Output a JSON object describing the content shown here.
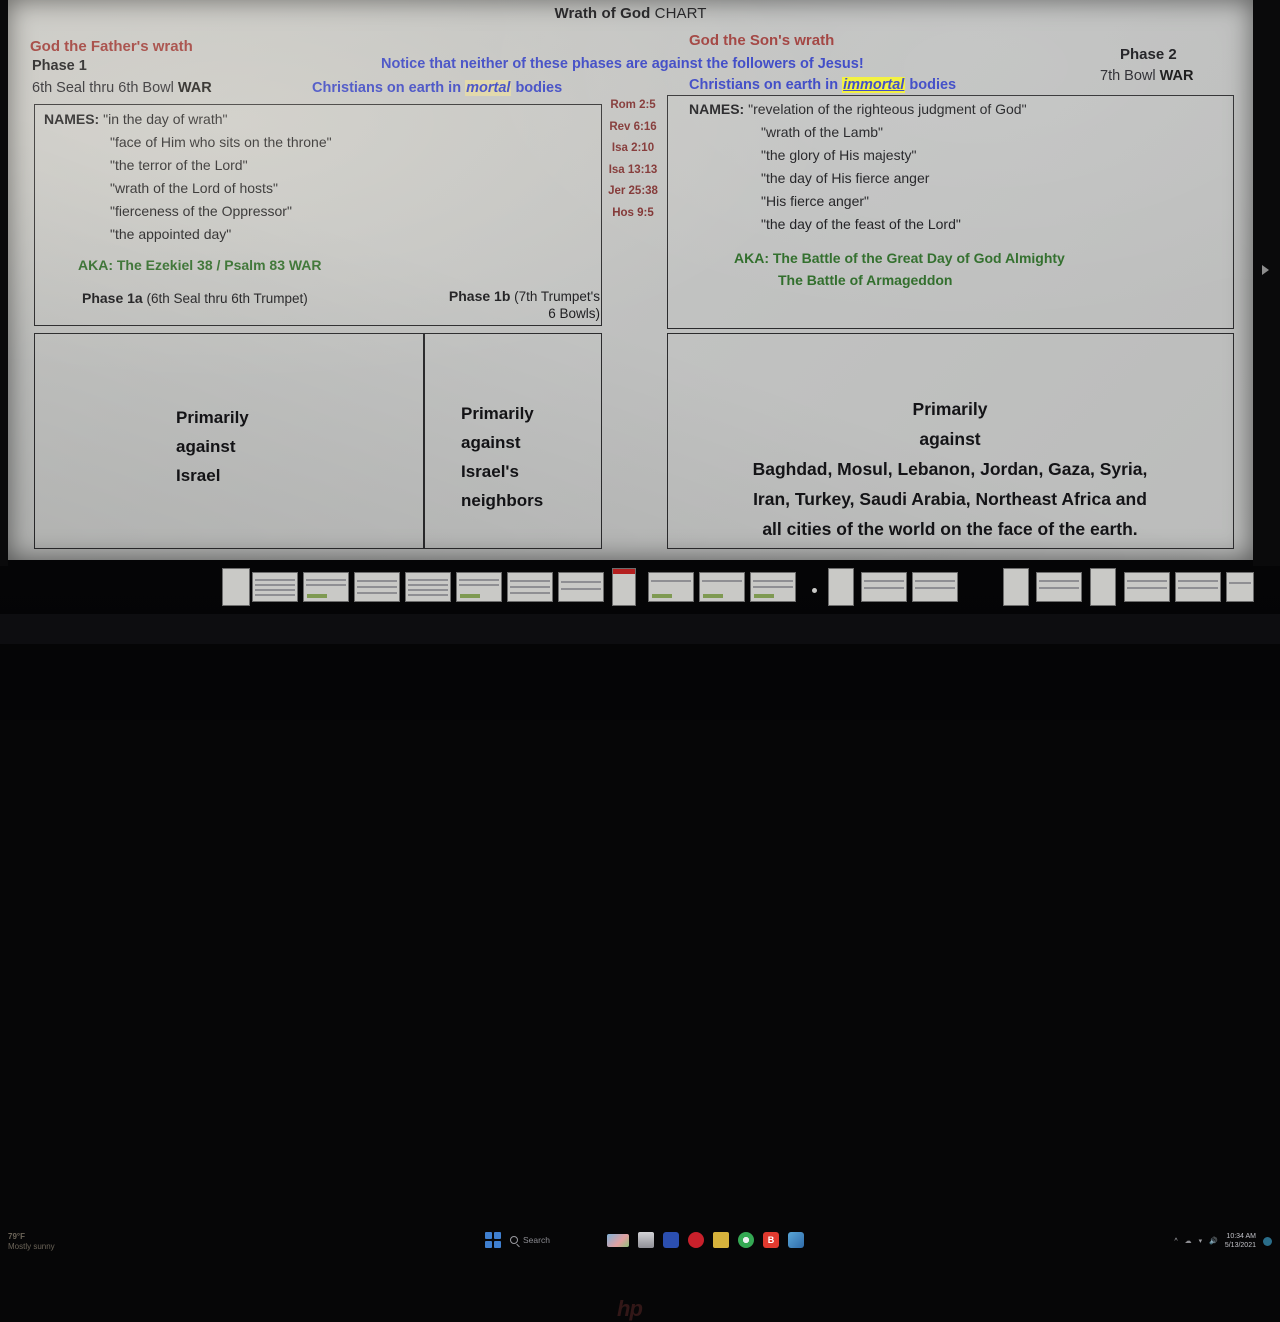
{
  "slide": {
    "title_bold": "Wrath of God",
    "title_rest": " CHART",
    "father": {
      "heading": "God the Father's wrath",
      "phase": "Phase 1",
      "sub_plain": "6th Seal thru 6th Bowl ",
      "sub_bold": "WAR"
    },
    "son": {
      "heading": "God the Son's wrath",
      "phase": "Phase 2",
      "sub_plain": "7th Bowl ",
      "sub_bold": "WAR"
    },
    "notice": "Notice that neither of these phases are against the followers of Jesus!",
    "mortal_line": {
      "pre": "Christians on earth in ",
      "highlight": "mortal",
      "post": " bodies"
    },
    "immortal_line": {
      "pre": "Christians on earth in ",
      "highlight": "immortal",
      "post": " bodies"
    },
    "references": [
      "Rom 2:5",
      "Rev 6:16",
      "Isa 2:10",
      "Isa 13:13",
      "Jer 25:38",
      "Hos 9:5"
    ],
    "left_panel": {
      "names_label": "NAMES:",
      "names": [
        "\"in the day of wrath\"",
        "\"face of Him who sits on the throne\"",
        "\"the terror of the Lord\"",
        "\"wrath of the Lord of hosts\"",
        "\"fierceness of the Oppressor\"",
        "\"the appointed day\""
      ],
      "aka": "AKA: The Ezekiel 38 / Psalm 83 WAR",
      "phase_1a_bold": "Phase 1a",
      "phase_1a_rest": " (6th Seal thru 6th Trumpet)",
      "phase_1b_bold": "Phase 1b",
      "phase_1b_rest": " (7th Trumpet's",
      "phase_1b_rest2": "6 Bowls)"
    },
    "right_panel": {
      "names_label": "NAMES:",
      "names": [
        "\"revelation of the righteous judgment of God\"",
        "\"wrath of the Lamb\"",
        "\"the glory of His majesty\"",
        "\"the day of His fierce anger",
        "\"His fierce anger\"",
        "\"the day of the feast of the Lord\""
      ],
      "aka_line1": "AKA: The Battle of the Great Day of God Almighty",
      "aka_line2": "The Battle of Armageddon"
    },
    "boxes": {
      "left_a": [
        "Primarily",
        "against",
        "Israel"
      ],
      "left_b": [
        "Primarily",
        "against",
        "Israel's",
        "neighbors"
      ],
      "right": [
        "Primarily",
        "against",
        "Baghdad, Mosul, Lebanon, Jordan, Gaza, Syria,",
        "Iran, Turkey, Saudi Arabia, Northeast Africa and",
        "all cities of the world on the face of the earth."
      ]
    }
  },
  "taskbar": {
    "weather_temp": "79°F",
    "weather_desc": "Mostly sunny",
    "search_placeholder": "Search",
    "clock_time": "10:34 AM",
    "clock_date": "5/13/2021"
  },
  "bezel": {
    "brand": "hp"
  },
  "colors": {
    "maroon": "#9d3a37",
    "blue": "#3340c4",
    "green": "#2f6d2a",
    "ref_red": "#7b2b2b",
    "highlight_tan": "#ded5a5",
    "highlight_yellow": "#f2f132",
    "slide_bg": "#c4c5c3"
  }
}
